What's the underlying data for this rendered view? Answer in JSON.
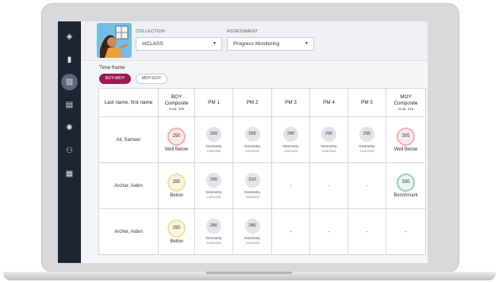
{
  "header": {
    "collection_label": "COLLECTION",
    "collection_value": "mCLASS",
    "assessment_label": "ASSESSMENT",
    "assessment_value": "Progress Monitoring"
  },
  "sidebar": {
    "items": [
      {
        "icon": "layers-icon",
        "glyph": "◈"
      },
      {
        "icon": "bookmark-icon",
        "glyph": "▮"
      },
      {
        "icon": "bar-chart-icon",
        "glyph": "▥"
      },
      {
        "icon": "document-icon",
        "glyph": "▤"
      },
      {
        "icon": "lightbulb-icon",
        "glyph": "✺"
      },
      {
        "icon": "users-icon",
        "glyph": "⚇"
      },
      {
        "icon": "apps-grid-icon",
        "glyph": "▦"
      }
    ]
  },
  "timeframe": {
    "label": "Time frame",
    "options": [
      "BOY-MOY",
      "MOY-EOY"
    ],
    "selected": "BOY-MOY"
  },
  "table": {
    "headers": {
      "name": "Last name, first name",
      "boy_title": "BOY",
      "boy_sub": "Composite",
      "boy_goal": "Goal: 300",
      "pm1": "PM 1",
      "pm2": "PM 2",
      "pm3": "PM 3",
      "pm4": "PM 4",
      "pm5": "PM 5",
      "moy_title": "MOY",
      "moy_sub": "Composite",
      "moy_goal": "Goal: 315"
    },
    "rows": [
      {
        "name": "Ali, Sameer",
        "boy": {
          "score": "250",
          "status": "Well Below"
        },
        "pm": [
          {
            "score": "260",
            "skill": "Geometry",
            "date": "10/5/2025"
          },
          {
            "score": "265",
            "skill": "Geometry",
            "date": "10/5/2025"
          },
          {
            "score": "290",
            "skill": "Geometry",
            "date": "10/5/2025"
          },
          {
            "score": "290",
            "skill": "Geometry",
            "date": "10/5/2025"
          },
          {
            "score": "295",
            "skill": "Geometry",
            "date": "10/5/2025"
          }
        ],
        "moy": {
          "score": "305",
          "status": "Well Below"
        }
      },
      {
        "name": "Archer, Aiden",
        "boy": {
          "score": "280",
          "status": "Below"
        },
        "pm": [
          {
            "score": "280",
            "skill": "Geometry",
            "date": "10/5/2025"
          },
          {
            "score": "310",
            "skill": "Geometry",
            "date": "10/5/2025"
          },
          {
            "empty": "-"
          },
          {
            "empty": "-"
          },
          {
            "empty": "-"
          }
        ],
        "moy": {
          "score": "330",
          "status": "Benchmark"
        }
      },
      {
        "name": "Archer, Aiden",
        "boy": {
          "score": "290",
          "status": "Below"
        },
        "pm": [
          {
            "score": "280",
            "skill": "Geometry",
            "date": "10/5/2025"
          },
          {
            "score": "280",
            "skill": "Geometry",
            "date": "10/5/2025"
          },
          {
            "empty": "-"
          },
          {
            "empty": "-"
          },
          {
            "empty": "-"
          }
        ],
        "moy": {
          "empty": "-"
        }
      }
    ]
  },
  "colors": {
    "sidebar": "#1d2533",
    "accent": "#a01758",
    "well_below": "#f2aeb2",
    "below": "#efe09f",
    "benchmark": "#98cfb6"
  }
}
